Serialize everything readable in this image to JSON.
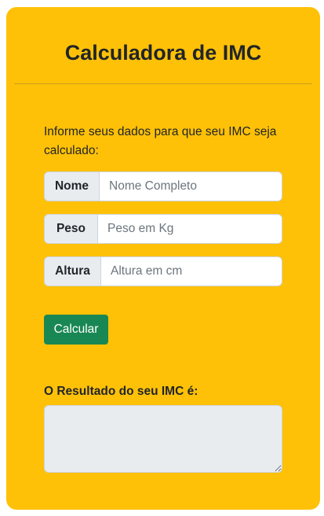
{
  "title": "Calculadora de IMC",
  "intro": "Informe seus dados para que seu IMC seja calculado:",
  "fields": [
    {
      "label": "Nome",
      "placeholder": "Nome Completo",
      "value": ""
    },
    {
      "label": "Peso",
      "placeholder": "Peso em Kg",
      "value": ""
    },
    {
      "label": "Altura",
      "placeholder": "Altura em cm",
      "value": ""
    }
  ],
  "button_label": "Calcular",
  "result_label": "O Resultado do seu IMC é:",
  "result_value": "",
  "colors": {
    "card_background": "#ffc107",
    "button_background": "#198754",
    "input_addon_background": "#e9ecef"
  }
}
